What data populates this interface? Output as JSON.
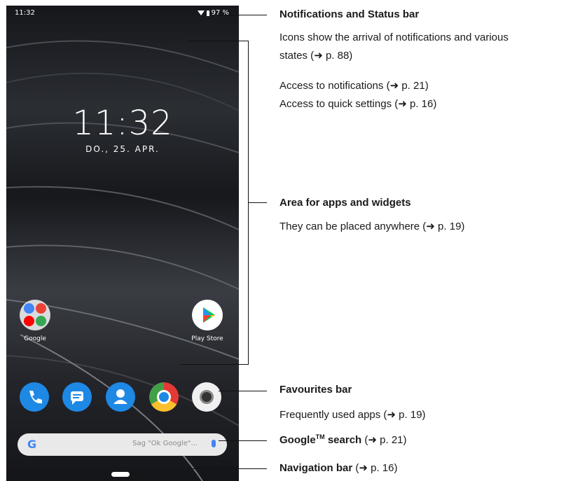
{
  "screen": {
    "status_time": "11:32",
    "battery_text": "97 %",
    "clock_time": "11:32",
    "clock_date": "DO., 25. APR.",
    "home_apps": [
      {
        "label": "Google",
        "icon": "google-folder-icon"
      },
      {
        "label": "Play Store",
        "icon": "play-store-icon"
      }
    ],
    "favourites": [
      {
        "icon": "phone-icon"
      },
      {
        "icon": "messages-icon"
      },
      {
        "icon": "contacts-icon"
      },
      {
        "icon": "chrome-icon"
      },
      {
        "icon": "camera-icon"
      }
    ],
    "search": {
      "logo": "G",
      "placeholder": "Sag \"Ok Google\"...",
      "icon": "mic-icon"
    }
  },
  "annotations": {
    "notifications": {
      "title": "Notifications and Status bar",
      "line1": "Icons show the arrival of notifications and various",
      "line2_prefix": "states (",
      "line2_ref": "p. 88)",
      "line3_prefix": "Access to notifications (",
      "line3_ref": "p. 21)",
      "line4_prefix": "Access to quick settings (",
      "line4_ref": "p. 16)"
    },
    "apps_area": {
      "title": "Area for apps and widgets",
      "desc_prefix": "They can be placed anywhere (",
      "desc_ref": "p. 19)"
    },
    "favourites": {
      "title": "Favourites bar",
      "desc_prefix": "Frequently used apps (",
      "desc_ref": "p. 19)"
    },
    "search": {
      "title_prefix": "Google",
      "title_tm": "TM",
      "title_suffix": " search",
      "ref_prefix": " (",
      "ref": "p. 21)"
    },
    "navigation": {
      "title": "Navigation bar",
      "ref_prefix": " (",
      "ref": "p. 16)"
    },
    "arrow_glyph": "➜"
  },
  "colors": {
    "brand_blue": "#1e88e5",
    "google_blue": "#4285f4"
  }
}
